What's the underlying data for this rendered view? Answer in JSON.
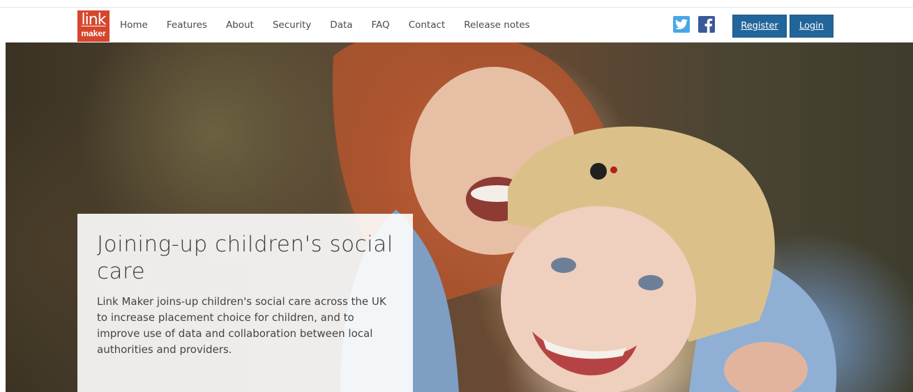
{
  "brand": {
    "logo_top": "link",
    "logo_bottom": "maker",
    "logo_color": "#d6462d"
  },
  "nav": {
    "links": [
      "Home",
      "Features",
      "About",
      "Security",
      "Data",
      "FAQ",
      "Contact",
      "Release notes"
    ]
  },
  "social": {
    "twitter_icon": "twitter-icon",
    "facebook_icon": "facebook-icon"
  },
  "auth": {
    "register_label": "Register",
    "login_label": "Login",
    "button_color": "#22659a"
  },
  "hero": {
    "image": "two-smiling-girls-hugging-photo",
    "title": "Joining-up children's social care",
    "text": "Link Maker joins-up children's social care across the UK to increase placement choice for children, and to improve use of data and collaboration between local authorities and providers."
  }
}
